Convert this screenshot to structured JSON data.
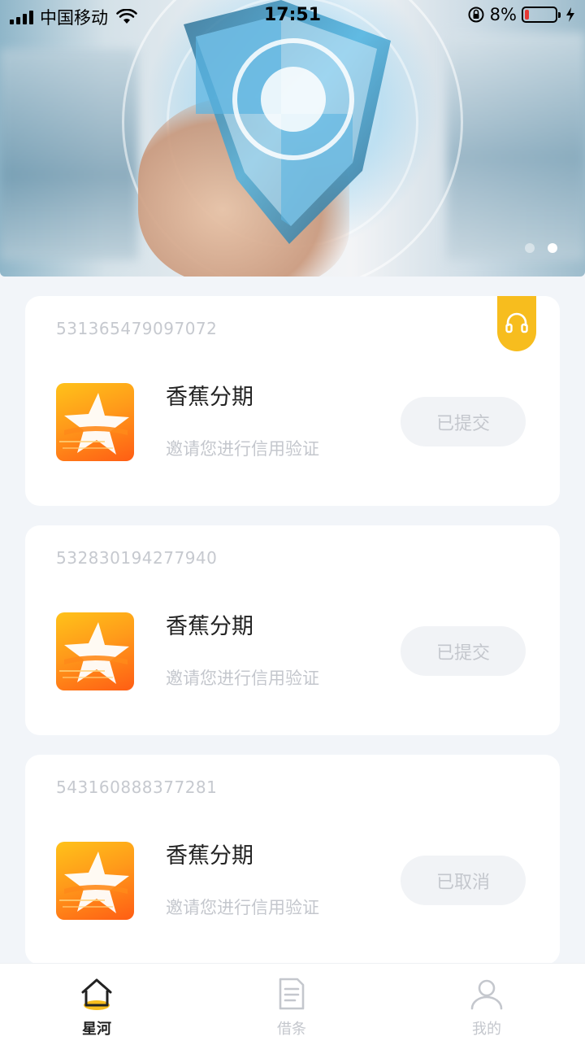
{
  "status_bar": {
    "carrier": "中国移动",
    "time": "17:51",
    "battery": "8%",
    "battery_level": 0.08,
    "icons": [
      "signal-icon",
      "wifi-icon",
      "rotation-lock-icon",
      "battery-icon",
      "charging-icon"
    ]
  },
  "banner": {
    "image": "shield-hand-security-banner",
    "slide_count": 2,
    "active_slide": 2
  },
  "records": [
    {
      "order_no": "531365479097072",
      "app_name": "香蕉分期",
      "description": "邀请您进行信用验证",
      "status": "已提交",
      "has_support_tag": true
    },
    {
      "order_no": "532830194277940",
      "app_name": "香蕉分期",
      "description": "邀请您进行信用验证",
      "status": "已提交",
      "has_support_tag": false
    },
    {
      "order_no": "543160888377281",
      "app_name": "香蕉分期",
      "description": "邀请您进行信用验证",
      "status": "已取消",
      "has_support_tag": false
    }
  ],
  "support_icon": "headset-icon",
  "tabbar": {
    "tabs": [
      {
        "label": "星河",
        "icon": "home-icon",
        "active": true
      },
      {
        "label": "借条",
        "icon": "document-icon",
        "active": false
      },
      {
        "label": "我的",
        "icon": "profile-icon",
        "active": false
      }
    ]
  },
  "colors": {
    "accent": "#f7bd1e",
    "background": "#f2f5f9",
    "muted_text": "#c4c7cd",
    "button_bg": "#f1f3f6"
  }
}
